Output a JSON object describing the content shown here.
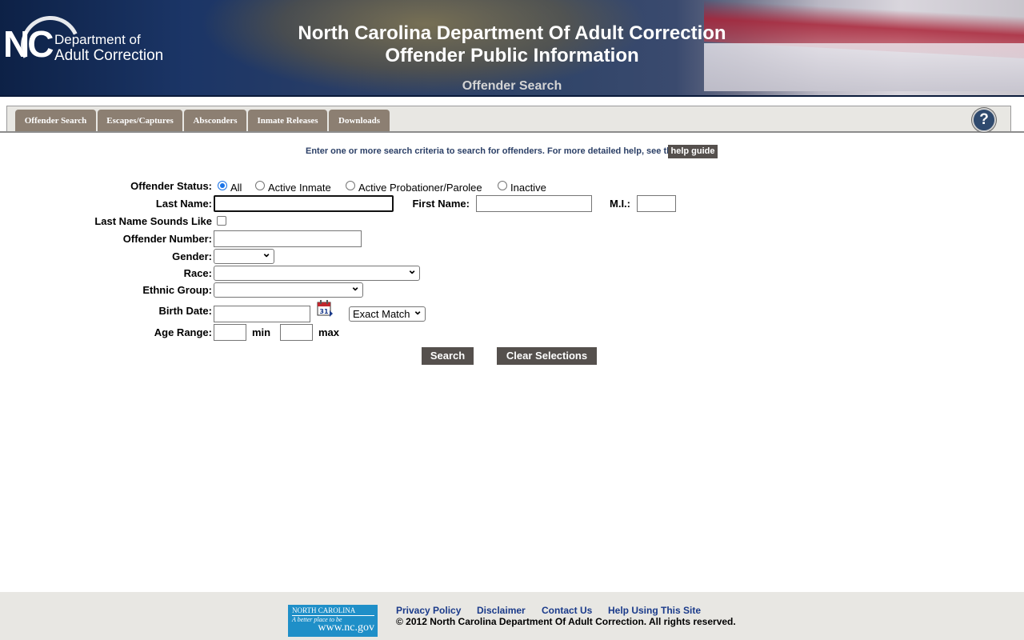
{
  "header": {
    "logo": {
      "abbr": "NC",
      "line1": "Department of",
      "line2": "Adult Correction"
    },
    "title_line1": "North Carolina Department Of Adult Correction",
    "title_line2": "Offender Public Information",
    "subtitle": "Offender Search"
  },
  "tabs": [
    {
      "label": "Offender Search"
    },
    {
      "label": "Escapes/Captures"
    },
    {
      "label": "Absconders"
    },
    {
      "label": "Inmate Releases"
    },
    {
      "label": "Downloads"
    }
  ],
  "help_icon": {
    "glyph": "?"
  },
  "instructions": "Enter one or more search criteria to search for offenders. For more detailed help, see the",
  "help_guide_label": "help guide",
  "form": {
    "offender_status": {
      "label": "Offender Status:",
      "options": [
        "All",
        "Active Inmate",
        "Active Probationer/Parolee",
        "Inactive"
      ],
      "selected": "All"
    },
    "last_name": {
      "label": "Last Name:",
      "value": ""
    },
    "first_name": {
      "label": "First Name:",
      "value": ""
    },
    "mi": {
      "label": "M.I.:",
      "value": ""
    },
    "sounds_like": {
      "label": "Last Name Sounds Like",
      "checked": false
    },
    "offender_number": {
      "label": "Offender Number:",
      "value": ""
    },
    "gender": {
      "label": "Gender:",
      "selected": ""
    },
    "race": {
      "label": "Race:",
      "selected": ""
    },
    "ethnic_group": {
      "label": "Ethnic Group:",
      "selected": ""
    },
    "birth_date": {
      "label": "Birth Date:",
      "value": "",
      "calendar_icon": "calendar-icon",
      "calendar_day": "31",
      "match": "Exact Match"
    },
    "age_range": {
      "label": "Age Range:",
      "min_label": "min",
      "max_label": "max",
      "min": "",
      "max": ""
    }
  },
  "buttons": {
    "search": "Search",
    "clear": "Clear Selections"
  },
  "footer": {
    "logo": {
      "line1": "NORTH CAROLINA",
      "line2": "A better place to be",
      "line3": "www.nc.gov"
    },
    "links": [
      "Privacy Policy",
      "Disclaimer",
      "Contact Us",
      "Help Using This Site"
    ],
    "copyright": "© 2012 North Carolina Department Of Adult Correction. All rights reserved."
  },
  "colors": {
    "tab_bg": "#8c7f72",
    "button_bg": "#55504d",
    "link": "#1a3a8a",
    "instructions_text": "#2b3f66"
  }
}
